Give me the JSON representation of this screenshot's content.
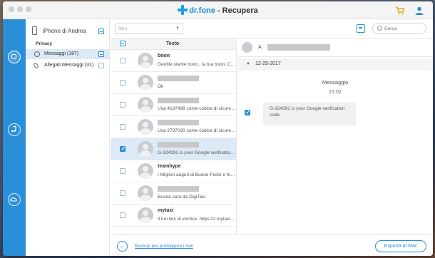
{
  "window": {
    "title_brand": "dr.fone",
    "title_sep": " - ",
    "title_page": "Recupera",
    "icons": [
      "cart-icon",
      "user-icon",
      "logo-plus-icon"
    ]
  },
  "sidebar_icons": [
    "device-restore-icon",
    "music-restore-icon",
    "cloud-restore-icon"
  ],
  "tree": {
    "device_name": "iPhone di Andrea",
    "section": "Privacy",
    "items": [
      {
        "label": "Messaggi (187)",
        "selected": true,
        "check": "partial"
      },
      {
        "label": "Allegati Messaggi (31)",
        "selected": false,
        "check": "none"
      }
    ]
  },
  "filter": {
    "select_value": "filtro"
  },
  "search": {
    "placeholder": "Cerca"
  },
  "list": {
    "header": "Testo",
    "rows": [
      {
        "sender": "boon",
        "preview": "Gentile utente boon,, la tua boon. Ca...",
        "checked": false,
        "selected": false
      },
      {
        "sender": "",
        "preview": "Ok",
        "checked": false,
        "selected": false
      },
      {
        "sender": "",
        "preview": "Usa 4187498 come codice di sicurez...",
        "checked": false,
        "selected": false
      },
      {
        "sender": "",
        "preview": "Usa 2787030 come codice di sicurez...",
        "checked": false,
        "selected": false
      },
      {
        "sender": "",
        "preview": "G-324291 is your Google verification...",
        "checked": true,
        "selected": true
      },
      {
        "sender": "teamhype",
        "preview": "I Migliori auguri di Buone Feste e feli...",
        "checked": false,
        "selected": false
      },
      {
        "sender": "",
        "preview": "Buona sera da DigiTaxi.",
        "checked": false,
        "selected": false
      },
      {
        "sender": "mytaxi",
        "preview": "Il tuo link di verifica: https://z.mytaxi.c...",
        "checked": false,
        "selected": false
      }
    ]
  },
  "detail": {
    "to_label": "A:",
    "date": "12-29-2017",
    "message_title": "Messaggio",
    "message_time": "21:02",
    "message_body": "G-324291 is your Google verification code."
  },
  "bottom": {
    "backup_link": "Backup per proteggere i dati",
    "export_label": "Esporta al Mac"
  },
  "colors": {
    "accent": "#2a8fd9",
    "selected_bg": "#dce9f6"
  }
}
